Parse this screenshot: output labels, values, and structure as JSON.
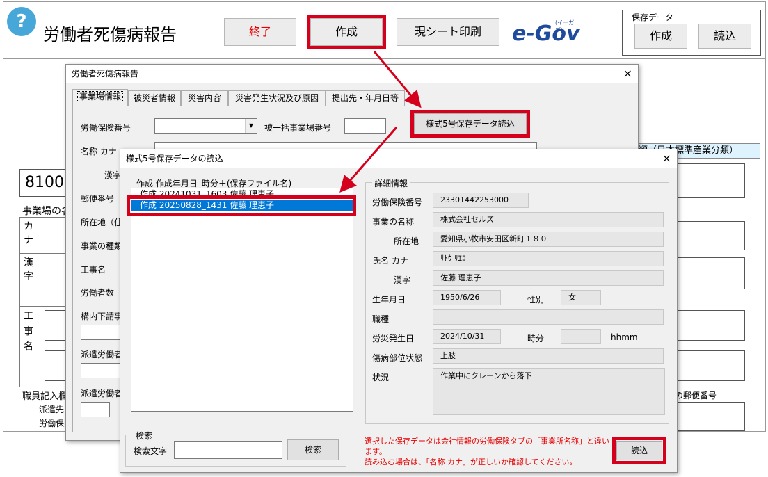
{
  "sheet": {
    "title": "労働者死傷病報告",
    "help_icon": "?",
    "buttons": {
      "end": "終了",
      "create": "作成",
      "print": "現シート印刷"
    },
    "egov_logo": "e-Gov",
    "egov_kana": "(イーガブ)",
    "save_group": {
      "legend": "保存データ",
      "create": "作成",
      "load": "読込"
    },
    "code": "8100",
    "industry_header": "類（日本標準産業分類）",
    "row_labels": {
      "workplace": "事業場の名",
      "kana": "カナ",
      "kanji": "漢字",
      "construction": "工事名",
      "staff": "職員記入欄",
      "dispatch": "派遣先の",
      "insurance": "労働保険",
      "postal": "の郵便番号"
    }
  },
  "main_dialog": {
    "title": "労働者死傷病報告",
    "close": "×",
    "tabs": [
      "事業場情報",
      "被災者情報",
      "災害内容",
      "災害発生状況及び原因",
      "提出先・年月日等"
    ],
    "load_form5_button": "様式5号保存データ読込",
    "labels": {
      "insurance_no": "労働保険番号",
      "batch_no": "被一括事業場番号",
      "name_kana": "名称 カナ",
      "kanji": "漢字",
      "postal": "郵便番号",
      "address": "所在地（住",
      "business_type": "事業の種類",
      "construction": "工事名",
      "workers": "労働者数",
      "subcontract": "構内下請事",
      "dispatch1": "派遣労働者",
      "dispatch2": "派遣労働者"
    }
  },
  "load_dialog": {
    "title": "様式5号保存データの読込",
    "close": "×",
    "list_header": "作成 作成年月日_時分＋(保存ファイル名)",
    "items": [
      "作成 20241031_1603 佐藤 理恵子",
      "作成 20250828_1431 佐藤 理恵子"
    ],
    "search": {
      "legend": "検索",
      "label": "検索文字",
      "value": "",
      "button": "検索"
    },
    "details": {
      "legend": "詳細情報",
      "insurance_no_label": "労働保険番号",
      "insurance_no": "23301442253000",
      "business_name_label": "事業の名称",
      "business_name": "株式会社セルズ",
      "address_label": "所在地",
      "address": "愛知県小牧市安田区新町１８０",
      "name_kana_label": "氏名 カナ",
      "name_kana": "ｻﾄｳ ﾘｴｺ",
      "kanji_label": "漢字",
      "kanji": "佐藤 理恵子",
      "birth_label": "生年月日",
      "birth": "1950/6/26",
      "sex_label": "性別",
      "sex": "女",
      "occupation_label": "職種",
      "occupation": "",
      "accident_date_label": "労災発生日",
      "accident_date": "2024/10/31",
      "time_label": "時分",
      "time": "",
      "time_unit": "hhmm",
      "injury_label": "傷病部位状態",
      "injury": "上肢",
      "situation_label": "状況",
      "situation": "作業中にクレーンから落下"
    },
    "warning_line1": "選択した保存データは会社情報の労働保険タブの「事業所名称」と違い",
    "warning_line2": "ます。",
    "warning_line3": "読み込む場合は、「名称 カナ」が正しいか確認してください。",
    "load_button": "読込"
  },
  "colors": {
    "highlight": "#d5001c",
    "selection": "#0078d7",
    "warning": "#e60000"
  }
}
